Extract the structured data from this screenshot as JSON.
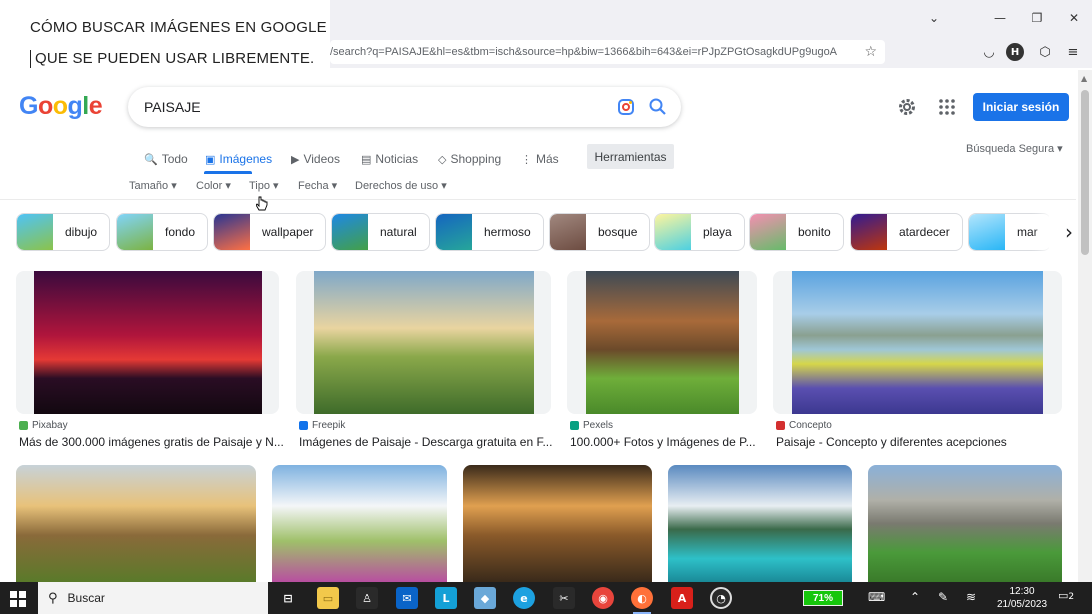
{
  "overlay": {
    "line1": "CÓMO BUSCAR IMÁGENES EN GOOGLE",
    "line2": "QUE SE PUEDEN USAR LIBREMENTE."
  },
  "browser": {
    "url": "/search?q=PAISAJE&hl=es&tbm=isch&source=hp&biw=1366&bih=643&ei=rPJpZPGtOsagkdUPg9ugoA",
    "profile_initial": "H"
  },
  "google": {
    "logo_letters": [
      "G",
      "o",
      "o",
      "g",
      "l",
      "e"
    ],
    "logo_colors": [
      "#4285f4",
      "#ea4335",
      "#fbbc05",
      "#4285f4",
      "#34a853",
      "#ea4335"
    ],
    "query": "PAISAJE",
    "signin_label": "Iniciar sesión",
    "safe_search": "Búsqueda Segura ▾",
    "tools_label": "Herramientas"
  },
  "tabs": [
    {
      "icon": "🔍",
      "label": "Todo",
      "active": false
    },
    {
      "icon": "▣",
      "label": "Imágenes",
      "active": true
    },
    {
      "icon": "▶",
      "label": "Videos",
      "active": false
    },
    {
      "icon": "▤",
      "label": "Noticias",
      "active": false
    },
    {
      "icon": "◇",
      "label": "Shopping",
      "active": false
    },
    {
      "icon": "⋮",
      "label": "Más",
      "active": false
    }
  ],
  "filters": [
    "Tamaño ▾",
    "Color ▾",
    "Tipo ▾",
    "Fecha ▾",
    "Derechos de uso ▾"
  ],
  "chips": [
    {
      "label": "dibujo",
      "colors": [
        "#8bc34a",
        "#4fc3f7"
      ]
    },
    {
      "label": "fondo",
      "colors": [
        "#7cb342",
        "#81d4fa"
      ]
    },
    {
      "label": "wallpaper",
      "colors": [
        "#ff7043",
        "#283593"
      ]
    },
    {
      "label": "natural",
      "colors": [
        "#43a047",
        "#1e88e5"
      ]
    },
    {
      "label": "hermoso",
      "colors": [
        "#26a69a",
        "#1565c0"
      ]
    },
    {
      "label": "bosque",
      "colors": [
        "#6d4c41",
        "#a1887f"
      ]
    },
    {
      "label": "playa",
      "colors": [
        "#4dd0e1",
        "#fff59d"
      ]
    },
    {
      "label": "bonito",
      "colors": [
        "#66bb6a",
        "#f48fb1"
      ]
    },
    {
      "label": "atardecer",
      "colors": [
        "#bf360c",
        "#311b92"
      ]
    },
    {
      "label": "mar",
      "colors": [
        "#29b6f6",
        "#b3e5fc"
      ]
    }
  ],
  "results_row1": [
    {
      "source": "Pixabay",
      "fav": "#4caf50",
      "title": "Más de 300.000 imágenes gratis de Paisaje y N...",
      "grad": "linear-gradient(180deg,#3a0a3d 0%,#b0153c 45%,#e53935 62%,#2a0d24 75%,#120810 100%)"
    },
    {
      "source": "Freepik",
      "fav": "#1273eb",
      "title": "Imágenes de Paisaje - Descarga gratuita en F...",
      "grad": "linear-gradient(180deg,#7fa8c9 0%,#e9d4a0 40%,#8aa84a 60%,#3e6b2a 100%)"
    },
    {
      "source": "Pexels",
      "fav": "#07a081",
      "title": "100.000+ Fotos y Imágenes de P...",
      "grad": "linear-gradient(180deg,#3e4a55 0%,#a86a3a 35%,#6b4a2a 55%,#6fae3a 75%,#4a8a2a 100%)"
    },
    {
      "source": "Concepto",
      "fav": "#d32f2f",
      "title": "Paisaje - Concepto y diferentes acepciones",
      "grad": "linear-gradient(180deg,#5aa3e0 0%,#a8cde8 30%,#8aa090 45%,#9fc7d6 55%,#d6d64a 65%,#5a4fb0 82%,#3c3890 100%)"
    }
  ],
  "results_row2": [
    {
      "grad": "linear-gradient(180deg,#c7d2d8 0%,#e8c27a 35%,#8a6a3a 60%,#5a7a2a 100%)"
    },
    {
      "grad": "linear-gradient(180deg,#7fb2e0 0%,#f4f6f8 35%,#9fc06a 65%,#b84fa0 100%)"
    },
    {
      "grad": "linear-gradient(180deg,#3a2a1a 0%,#e0a050 35%,#8a5a2a 60%,#3a2a1a 100%)"
    },
    {
      "grad": "linear-gradient(180deg,#5a8ac0 0%,#e8eef2 35%,#3a6a4a 55%,#2ec0c8 80%,#1a8a98 100%)"
    },
    {
      "grad": "linear-gradient(180deg,#8ab0d8 0%,#b0b0a8 30%,#7a7a70 50%,#4a9a3a 75%,#3a7a2a 100%)"
    }
  ],
  "taskbar": {
    "search_placeholder": "Buscar",
    "battery": "71%",
    "time": "12:30",
    "date": "21/05/2023",
    "notifications": "2"
  }
}
